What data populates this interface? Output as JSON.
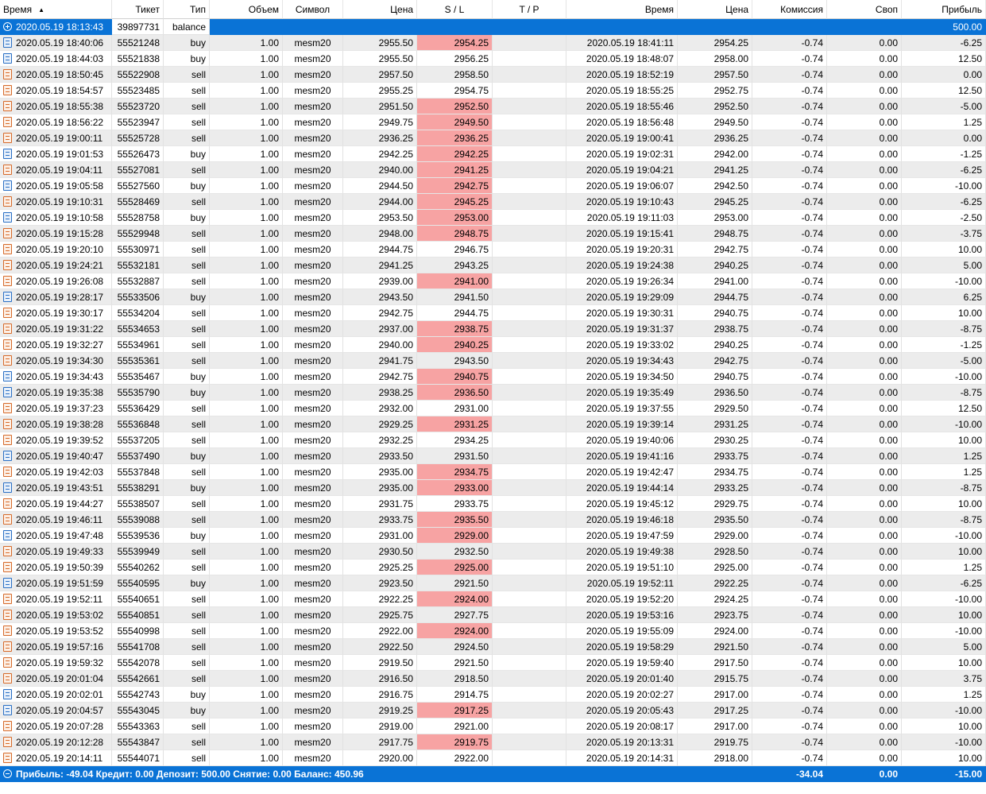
{
  "columns": [
    "Время",
    "Тикет",
    "Тип",
    "Объем",
    "Символ",
    "Цена",
    "S / L",
    "T / P",
    "Время",
    "Цена",
    "Комиссия",
    "Своп",
    "Прибыль"
  ],
  "sort_indicator": "▲",
  "balance_row": {
    "time": "2020.05.19 18:13:43",
    "ticket": "39897731",
    "type": "balance",
    "profit": "500.00"
  },
  "rows": [
    [
      "2020.05.19 18:40:06",
      "55521248",
      "buy",
      "1.00",
      "mesm20",
      "2955.50",
      "2954.25",
      "",
      "2020.05.19 18:41:11",
      "2954.25",
      "-0.74",
      "0.00",
      "-6.25",
      1
    ],
    [
      "2020.05.19 18:44:03",
      "55521838",
      "buy",
      "1.00",
      "mesm20",
      "2955.50",
      "2956.25",
      "",
      "2020.05.19 18:48:07",
      "2958.00",
      "-0.74",
      "0.00",
      "12.50",
      0
    ],
    [
      "2020.05.19 18:50:45",
      "55522908",
      "sell",
      "1.00",
      "mesm20",
      "2957.50",
      "2958.50",
      "",
      "2020.05.19 18:52:19",
      "2957.50",
      "-0.74",
      "0.00",
      "0.00",
      0
    ],
    [
      "2020.05.19 18:54:57",
      "55523485",
      "sell",
      "1.00",
      "mesm20",
      "2955.25",
      "2954.75",
      "",
      "2020.05.19 18:55:25",
      "2952.75",
      "-0.74",
      "0.00",
      "12.50",
      0
    ],
    [
      "2020.05.19 18:55:38",
      "55523720",
      "sell",
      "1.00",
      "mesm20",
      "2951.50",
      "2952.50",
      "",
      "2020.05.19 18:55:46",
      "2952.50",
      "-0.74",
      "0.00",
      "-5.00",
      1
    ],
    [
      "2020.05.19 18:56:22",
      "55523947",
      "sell",
      "1.00",
      "mesm20",
      "2949.75",
      "2949.50",
      "",
      "2020.05.19 18:56:48",
      "2949.50",
      "-0.74",
      "0.00",
      "1.25",
      1
    ],
    [
      "2020.05.19 19:00:11",
      "55525728",
      "sell",
      "1.00",
      "mesm20",
      "2936.25",
      "2936.25",
      "",
      "2020.05.19 19:00:41",
      "2936.25",
      "-0.74",
      "0.00",
      "0.00",
      1
    ],
    [
      "2020.05.19 19:01:53",
      "55526473",
      "buy",
      "1.00",
      "mesm20",
      "2942.25",
      "2942.25",
      "",
      "2020.05.19 19:02:31",
      "2942.00",
      "-0.74",
      "0.00",
      "-1.25",
      1
    ],
    [
      "2020.05.19 19:04:11",
      "55527081",
      "sell",
      "1.00",
      "mesm20",
      "2940.00",
      "2941.25",
      "",
      "2020.05.19 19:04:21",
      "2941.25",
      "-0.74",
      "0.00",
      "-6.25",
      1
    ],
    [
      "2020.05.19 19:05:58",
      "55527560",
      "buy",
      "1.00",
      "mesm20",
      "2944.50",
      "2942.75",
      "",
      "2020.05.19 19:06:07",
      "2942.50",
      "-0.74",
      "0.00",
      "-10.00",
      1
    ],
    [
      "2020.05.19 19:10:31",
      "55528469",
      "sell",
      "1.00",
      "mesm20",
      "2944.00",
      "2945.25",
      "",
      "2020.05.19 19:10:43",
      "2945.25",
      "-0.74",
      "0.00",
      "-6.25",
      1
    ],
    [
      "2020.05.19 19:10:58",
      "55528758",
      "buy",
      "1.00",
      "mesm20",
      "2953.50",
      "2953.00",
      "",
      "2020.05.19 19:11:03",
      "2953.00",
      "-0.74",
      "0.00",
      "-2.50",
      1
    ],
    [
      "2020.05.19 19:15:28",
      "55529948",
      "sell",
      "1.00",
      "mesm20",
      "2948.00",
      "2948.75",
      "",
      "2020.05.19 19:15:41",
      "2948.75",
      "-0.74",
      "0.00",
      "-3.75",
      1
    ],
    [
      "2020.05.19 19:20:10",
      "55530971",
      "sell",
      "1.00",
      "mesm20",
      "2944.75",
      "2946.75",
      "",
      "2020.05.19 19:20:31",
      "2942.75",
      "-0.74",
      "0.00",
      "10.00",
      0
    ],
    [
      "2020.05.19 19:24:21",
      "55532181",
      "sell",
      "1.00",
      "mesm20",
      "2941.25",
      "2943.25",
      "",
      "2020.05.19 19:24:38",
      "2940.25",
      "-0.74",
      "0.00",
      "5.00",
      0
    ],
    [
      "2020.05.19 19:26:08",
      "55532887",
      "sell",
      "1.00",
      "mesm20",
      "2939.00",
      "2941.00",
      "",
      "2020.05.19 19:26:34",
      "2941.00",
      "-0.74",
      "0.00",
      "-10.00",
      1
    ],
    [
      "2020.05.19 19:28:17",
      "55533506",
      "buy",
      "1.00",
      "mesm20",
      "2943.50",
      "2941.50",
      "",
      "2020.05.19 19:29:09",
      "2944.75",
      "-0.74",
      "0.00",
      "6.25",
      0
    ],
    [
      "2020.05.19 19:30:17",
      "55534204",
      "sell",
      "1.00",
      "mesm20",
      "2942.75",
      "2944.75",
      "",
      "2020.05.19 19:30:31",
      "2940.75",
      "-0.74",
      "0.00",
      "10.00",
      0
    ],
    [
      "2020.05.19 19:31:22",
      "55534653",
      "sell",
      "1.00",
      "mesm20",
      "2937.00",
      "2938.75",
      "",
      "2020.05.19 19:31:37",
      "2938.75",
      "-0.74",
      "0.00",
      "-8.75",
      1
    ],
    [
      "2020.05.19 19:32:27",
      "55534961",
      "sell",
      "1.00",
      "mesm20",
      "2940.00",
      "2940.25",
      "",
      "2020.05.19 19:33:02",
      "2940.25",
      "-0.74",
      "0.00",
      "-1.25",
      1
    ],
    [
      "2020.05.19 19:34:30",
      "55535361",
      "sell",
      "1.00",
      "mesm20",
      "2941.75",
      "2943.50",
      "",
      "2020.05.19 19:34:43",
      "2942.75",
      "-0.74",
      "0.00",
      "-5.00",
      0
    ],
    [
      "2020.05.19 19:34:43",
      "55535467",
      "buy",
      "1.00",
      "mesm20",
      "2942.75",
      "2940.75",
      "",
      "2020.05.19 19:34:50",
      "2940.75",
      "-0.74",
      "0.00",
      "-10.00",
      1
    ],
    [
      "2020.05.19 19:35:38",
      "55535790",
      "buy",
      "1.00",
      "mesm20",
      "2938.25",
      "2936.50",
      "",
      "2020.05.19 19:35:49",
      "2936.50",
      "-0.74",
      "0.00",
      "-8.75",
      1
    ],
    [
      "2020.05.19 19:37:23",
      "55536429",
      "sell",
      "1.00",
      "mesm20",
      "2932.00",
      "2931.00",
      "",
      "2020.05.19 19:37:55",
      "2929.50",
      "-0.74",
      "0.00",
      "12.50",
      0
    ],
    [
      "2020.05.19 19:38:28",
      "55536848",
      "sell",
      "1.00",
      "mesm20",
      "2929.25",
      "2931.25",
      "",
      "2020.05.19 19:39:14",
      "2931.25",
      "-0.74",
      "0.00",
      "-10.00",
      1
    ],
    [
      "2020.05.19 19:39:52",
      "55537205",
      "sell",
      "1.00",
      "mesm20",
      "2932.25",
      "2934.25",
      "",
      "2020.05.19 19:40:06",
      "2930.25",
      "-0.74",
      "0.00",
      "10.00",
      0
    ],
    [
      "2020.05.19 19:40:47",
      "55537490",
      "buy",
      "1.00",
      "mesm20",
      "2933.50",
      "2931.50",
      "",
      "2020.05.19 19:41:16",
      "2933.75",
      "-0.74",
      "0.00",
      "1.25",
      0
    ],
    [
      "2020.05.19 19:42:03",
      "55537848",
      "sell",
      "1.00",
      "mesm20",
      "2935.00",
      "2934.75",
      "",
      "2020.05.19 19:42:47",
      "2934.75",
      "-0.74",
      "0.00",
      "1.25",
      1
    ],
    [
      "2020.05.19 19:43:51",
      "55538291",
      "buy",
      "1.00",
      "mesm20",
      "2935.00",
      "2933.00",
      "",
      "2020.05.19 19:44:14",
      "2933.25",
      "-0.74",
      "0.00",
      "-8.75",
      1
    ],
    [
      "2020.05.19 19:44:27",
      "55538507",
      "sell",
      "1.00",
      "mesm20",
      "2931.75",
      "2933.75",
      "",
      "2020.05.19 19:45:12",
      "2929.75",
      "-0.74",
      "0.00",
      "10.00",
      0
    ],
    [
      "2020.05.19 19:46:11",
      "55539088",
      "sell",
      "1.00",
      "mesm20",
      "2933.75",
      "2935.50",
      "",
      "2020.05.19 19:46:18",
      "2935.50",
      "-0.74",
      "0.00",
      "-8.75",
      1
    ],
    [
      "2020.05.19 19:47:48",
      "55539536",
      "buy",
      "1.00",
      "mesm20",
      "2931.00",
      "2929.00",
      "",
      "2020.05.19 19:47:59",
      "2929.00",
      "-0.74",
      "0.00",
      "-10.00",
      1
    ],
    [
      "2020.05.19 19:49:33",
      "55539949",
      "sell",
      "1.00",
      "mesm20",
      "2930.50",
      "2932.50",
      "",
      "2020.05.19 19:49:38",
      "2928.50",
      "-0.74",
      "0.00",
      "10.00",
      0
    ],
    [
      "2020.05.19 19:50:39",
      "55540262",
      "sell",
      "1.00",
      "mesm20",
      "2925.25",
      "2925.00",
      "",
      "2020.05.19 19:51:10",
      "2925.00",
      "-0.74",
      "0.00",
      "1.25",
      1
    ],
    [
      "2020.05.19 19:51:59",
      "55540595",
      "buy",
      "1.00",
      "mesm20",
      "2923.50",
      "2921.50",
      "",
      "2020.05.19 19:52:11",
      "2922.25",
      "-0.74",
      "0.00",
      "-6.25",
      0
    ],
    [
      "2020.05.19 19:52:11",
      "55540651",
      "sell",
      "1.00",
      "mesm20",
      "2922.25",
      "2924.00",
      "",
      "2020.05.19 19:52:20",
      "2924.25",
      "-0.74",
      "0.00",
      "-10.00",
      1
    ],
    [
      "2020.05.19 19:53:02",
      "55540851",
      "sell",
      "1.00",
      "mesm20",
      "2925.75",
      "2927.75",
      "",
      "2020.05.19 19:53:16",
      "2923.75",
      "-0.74",
      "0.00",
      "10.00",
      0
    ],
    [
      "2020.05.19 19:53:52",
      "55540998",
      "sell",
      "1.00",
      "mesm20",
      "2922.00",
      "2924.00",
      "",
      "2020.05.19 19:55:09",
      "2924.00",
      "-0.74",
      "0.00",
      "-10.00",
      1
    ],
    [
      "2020.05.19 19:57:16",
      "55541708",
      "sell",
      "1.00",
      "mesm20",
      "2922.50",
      "2924.50",
      "",
      "2020.05.19 19:58:29",
      "2921.50",
      "-0.74",
      "0.00",
      "5.00",
      0
    ],
    [
      "2020.05.19 19:59:32",
      "55542078",
      "sell",
      "1.00",
      "mesm20",
      "2919.50",
      "2921.50",
      "",
      "2020.05.19 19:59:40",
      "2917.50",
      "-0.74",
      "0.00",
      "10.00",
      0
    ],
    [
      "2020.05.19 20:01:04",
      "55542661",
      "sell",
      "1.00",
      "mesm20",
      "2916.50",
      "2918.50",
      "",
      "2020.05.19 20:01:40",
      "2915.75",
      "-0.74",
      "0.00",
      "3.75",
      0
    ],
    [
      "2020.05.19 20:02:01",
      "55542743",
      "buy",
      "1.00",
      "mesm20",
      "2916.75",
      "2914.75",
      "",
      "2020.05.19 20:02:27",
      "2917.00",
      "-0.74",
      "0.00",
      "1.25",
      0
    ],
    [
      "2020.05.19 20:04:57",
      "55543045",
      "buy",
      "1.00",
      "mesm20",
      "2919.25",
      "2917.25",
      "",
      "2020.05.19 20:05:43",
      "2917.25",
      "-0.74",
      "0.00",
      "-10.00",
      1
    ],
    [
      "2020.05.19 20:07:28",
      "55543363",
      "sell",
      "1.00",
      "mesm20",
      "2919.00",
      "2921.00",
      "",
      "2020.05.19 20:08:17",
      "2917.00",
      "-0.74",
      "0.00",
      "10.00",
      0
    ],
    [
      "2020.05.19 20:12:28",
      "55543847",
      "sell",
      "1.00",
      "mesm20",
      "2917.75",
      "2919.75",
      "",
      "2020.05.19 20:13:31",
      "2919.75",
      "-0.74",
      "0.00",
      "-10.00",
      1
    ],
    [
      "2020.05.19 20:14:11",
      "55544071",
      "sell",
      "1.00",
      "mesm20",
      "2920.00",
      "2922.00",
      "",
      "2020.05.19 20:14:31",
      "2918.00",
      "-0.74",
      "0.00",
      "10.00",
      0
    ]
  ],
  "footer": {
    "summary": "Прибыль: -49.04  Кредит: 0.00  Депозит: 500.00  Снятие: 0.00  Баланс: 450.96",
    "commission": "-34.04",
    "swap": "0.00",
    "profit": "-15.00"
  },
  "colors": {
    "selection": "#0a73d6",
    "sl_hit": "#f7a3a3",
    "alt_row": "#ececec",
    "buy_icon": "#2a6fc4",
    "sell_icon": "#d66a2a"
  },
  "icons": {
    "order": "document-icon",
    "balance": "balance-circle-icon",
    "collapse": "collapse-circle-icon"
  }
}
